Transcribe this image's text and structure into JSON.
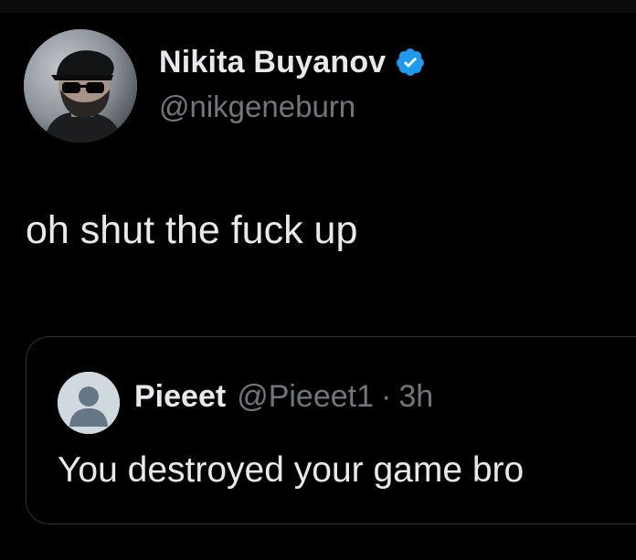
{
  "tweet": {
    "author": {
      "display_name": "Nikita Buyanov",
      "handle": "@nikgeneburn",
      "verified": true,
      "avatar_icon": "profile-photo"
    },
    "text": "oh shut the fuck up"
  },
  "quoted_tweet": {
    "author": {
      "display_name": "Pieeet",
      "handle": "@Pieeet1",
      "avatar_icon": "default-user-icon"
    },
    "separator": "·",
    "time": "3h",
    "text": "You destroyed your game bro"
  },
  "colors": {
    "background": "#000000",
    "primary_text": "#e7e9ea",
    "secondary_text": "#71767b",
    "verified_blue": "#1d9bf0",
    "card_border": "#2f3336"
  }
}
